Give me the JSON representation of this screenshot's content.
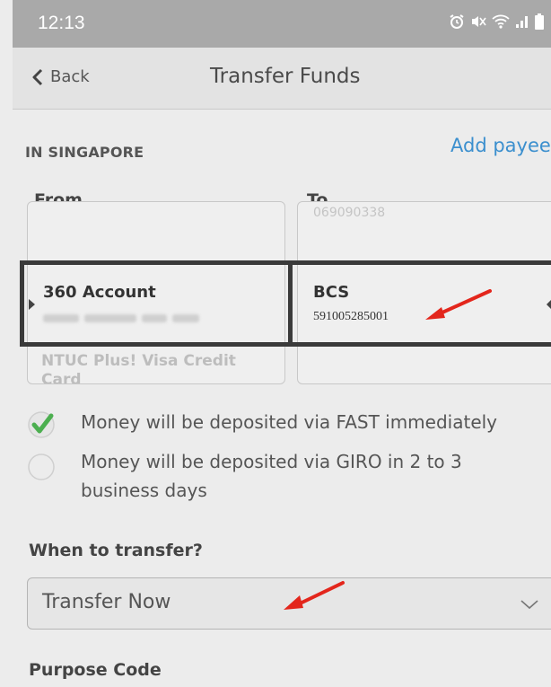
{
  "status_bar": {
    "time": "12:13"
  },
  "nav": {
    "back_label": "Back",
    "title": "Transfer Funds"
  },
  "section": {
    "label": "IN SINGAPORE",
    "add_payee_label": "Add payee"
  },
  "from": {
    "label": "From",
    "selected_name": "360 Account",
    "below_option": "NTUC Plus! Visa Credit Card"
  },
  "to": {
    "label": "To",
    "above_option": "069090338",
    "selected_name": "BCS",
    "selected_account": "591005285001"
  },
  "deposit_options": [
    {
      "text": "Money will be deposited via FAST immediately",
      "selected": true
    },
    {
      "text": "Money will be deposited via GIRO in 2 to 3 business days",
      "selected": false
    }
  ],
  "when": {
    "label": "When to transfer?",
    "value": "Transfer Now"
  },
  "purpose": {
    "label": "Purpose Code"
  },
  "colors": {
    "accent": "#3b8fce",
    "check": "#4caf50",
    "annotation_arrow": "#e3261c"
  }
}
